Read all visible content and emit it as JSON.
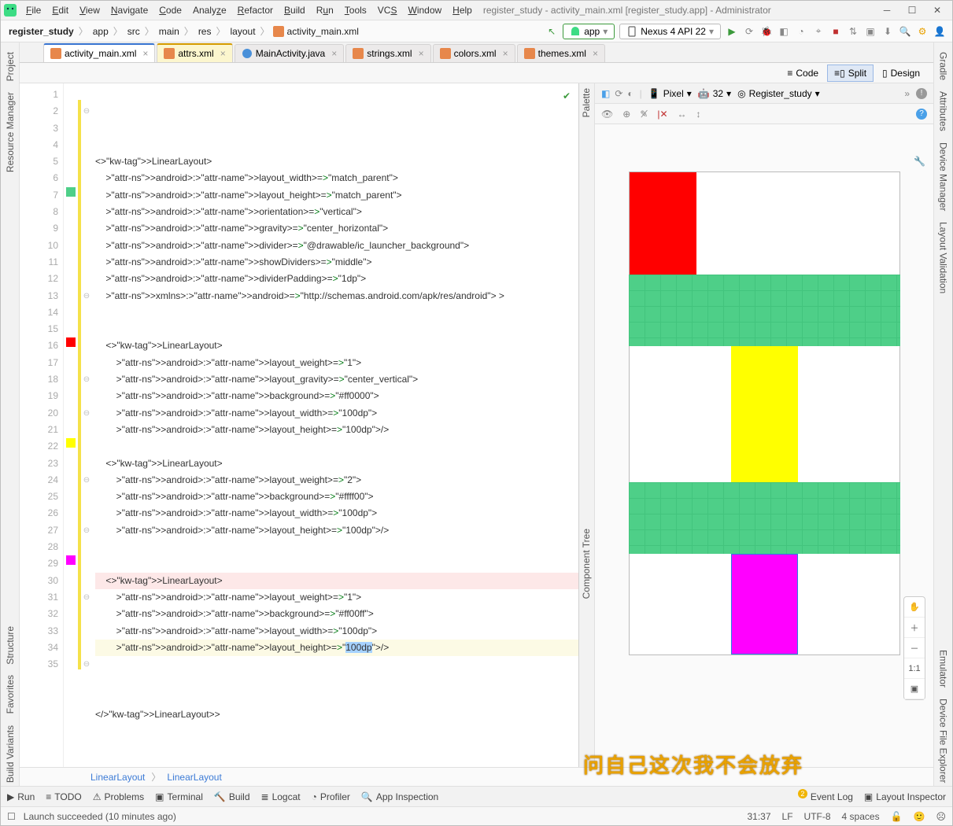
{
  "window_title": "register_study - activity_main.xml [register_study.app] - Administrator",
  "menu": [
    "File",
    "Edit",
    "View",
    "Navigate",
    "Code",
    "Analyze",
    "Refactor",
    "Build",
    "Run",
    "Tools",
    "VCS",
    "Window",
    "Help"
  ],
  "breadcrumbs": [
    "register_study",
    "app",
    "src",
    "main",
    "res",
    "layout",
    "activity_main.xml"
  ],
  "run_config": "app",
  "device": "Nexus 4 API 22",
  "tabs": [
    {
      "name": "activity_main.xml",
      "active": true,
      "type": "xml"
    },
    {
      "name": "attrs.xml",
      "active": false,
      "type": "xml",
      "highlight": true
    },
    {
      "name": "MainActivity.java",
      "active": false,
      "type": "java"
    },
    {
      "name": "strings.xml",
      "active": false,
      "type": "xml"
    },
    {
      "name": "colors.xml",
      "active": false,
      "type": "xml"
    },
    {
      "name": "themes.xml",
      "active": false,
      "type": "xml"
    }
  ],
  "view_modes": {
    "code": "Code",
    "split": "Split",
    "design": "Design",
    "selected": "Split"
  },
  "left_tools": [
    "Project",
    "Resource Manager",
    "Structure",
    "Favorites",
    "Build Variants"
  ],
  "right_tools": [
    "Gradle",
    "Attributes",
    "Device Manager",
    "Layout Validation",
    "Emulator",
    "Device File Explorer"
  ],
  "design_bar": {
    "device": "Pixel",
    "api": "32",
    "theme": "Register_study"
  },
  "code_lines": [
    {
      "n": 1,
      "txt": ""
    },
    {
      "n": 2,
      "txt": "<LinearLayout"
    },
    {
      "n": 3,
      "txt": "    android:layout_width=\"match_parent\""
    },
    {
      "n": 4,
      "txt": "    android:layout_height=\"match_parent\""
    },
    {
      "n": 5,
      "txt": "    android:orientation=\"vertical\""
    },
    {
      "n": 6,
      "txt": "    android:gravity=\"center_horizontal\""
    },
    {
      "n": 7,
      "txt": "    android:divider=\"@drawable/ic_launcher_background\"",
      "sw": "#4ecf88"
    },
    {
      "n": 8,
      "txt": "    android:showDividers=\"middle\""
    },
    {
      "n": 9,
      "txt": "    android:dividerPadding=\"1dp\""
    },
    {
      "n": 10,
      "txt": "    xmlns:android=\"http://schemas.android.com/apk/res/android\" >"
    },
    {
      "n": 11,
      "txt": ""
    },
    {
      "n": 12,
      "txt": ""
    },
    {
      "n": 13,
      "txt": "    <LinearLayout"
    },
    {
      "n": 14,
      "txt": "        android:layout_weight=\"1\""
    },
    {
      "n": 15,
      "txt": "        android:layout_gravity=\"center_vertical\""
    },
    {
      "n": 16,
      "txt": "        android:background=\"#ff0000\"",
      "sw": "#ff0000"
    },
    {
      "n": 17,
      "txt": "        android:layout_width=\"100dp\""
    },
    {
      "n": 18,
      "txt": "        android:layout_height=\"100dp\"/>"
    },
    {
      "n": 19,
      "txt": ""
    },
    {
      "n": 20,
      "txt": "    <LinearLayout"
    },
    {
      "n": 21,
      "txt": "        android:layout_weight=\"2\""
    },
    {
      "n": 22,
      "txt": "        android:background=\"#ffff00\"",
      "sw": "#ffff00"
    },
    {
      "n": 23,
      "txt": "        android:layout_width=\"100dp\""
    },
    {
      "n": 24,
      "txt": "        android:layout_height=\"100dp\"/>"
    },
    {
      "n": 25,
      "txt": ""
    },
    {
      "n": 26,
      "txt": ""
    },
    {
      "n": 27,
      "txt": "    <LinearLayout",
      "pink": true
    },
    {
      "n": 28,
      "txt": "        android:layout_weight=\"1\""
    },
    {
      "n": 29,
      "txt": "        android:background=\"#ff00ff\"",
      "sw": "#ff00ff"
    },
    {
      "n": 30,
      "txt": "        android:layout_width=\"100dp\""
    },
    {
      "n": 31,
      "txt": "        android:layout_height=\"100dp\"/>",
      "caret": true,
      "hl": true,
      "sel": "100dp"
    },
    {
      "n": 32,
      "txt": ""
    },
    {
      "n": 33,
      "txt": ""
    },
    {
      "n": 34,
      "txt": ""
    },
    {
      "n": 35,
      "txt": "</LinearLayout>"
    }
  ],
  "bottom_crumbs": [
    "LinearLayout",
    "LinearLayout"
  ],
  "tool_buttons": [
    "Run",
    "TODO",
    "Problems",
    "Terminal",
    "Build",
    "Logcat",
    "Profiler",
    "App Inspection"
  ],
  "event_log": "Event Log",
  "layout_inspector": "Layout Inspector",
  "status": {
    "msg": "Launch succeeded (10 minutes ago)",
    "pos": "31:37",
    "lf": "LF",
    "enc": "UTF-8",
    "indent": "4 spaces"
  },
  "watermark": "问自己这次我不会放弃",
  "palette_label": "Palette",
  "component_tree": "Component Tree"
}
